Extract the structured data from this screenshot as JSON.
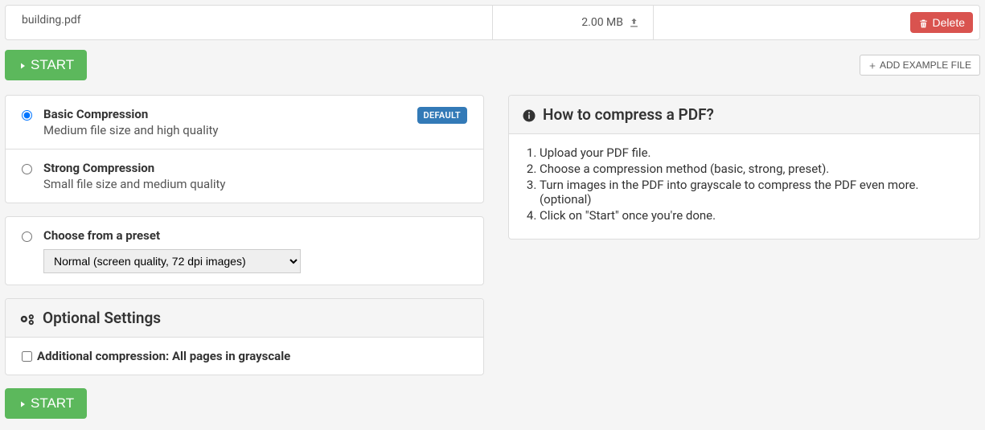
{
  "file": {
    "name": "building.pdf",
    "size": "2.00 MB",
    "delete_label": "Delete"
  },
  "toolbar": {
    "start_label": "START",
    "add_example_label": "ADD EXAMPLE FILE"
  },
  "compression": {
    "basic": {
      "title": "Basic Compression",
      "desc": "Medium file size and high quality",
      "badge": "DEFAULT"
    },
    "strong": {
      "title": "Strong Compression",
      "desc": "Small file size and medium quality"
    },
    "preset": {
      "title": "Choose from a preset",
      "selected": "Normal (screen quality, 72 dpi images)"
    }
  },
  "optional": {
    "header": "Optional Settings",
    "grayscale_label": "Additional compression: All pages in grayscale"
  },
  "how": {
    "title": "How to compress a PDF?",
    "steps": [
      "Upload your PDF file.",
      "Choose a compression method (basic, strong, preset).",
      "Turn images in the PDF into grayscale to compress the PDF even more. (optional)",
      "Click on \"Start\" once you're done."
    ]
  }
}
